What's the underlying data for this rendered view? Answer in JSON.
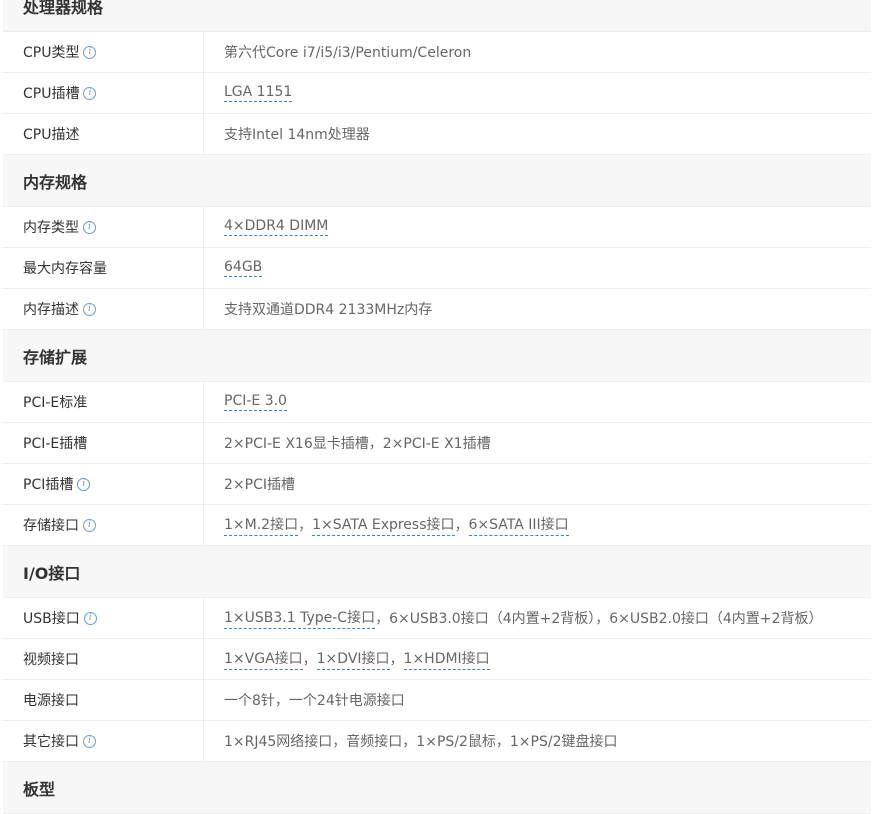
{
  "sections": [
    {
      "title": "处理器规格",
      "rows": [
        {
          "label": "CPU类型",
          "info": true,
          "parts": [
            {
              "text": "第六代Core i7/i5/i3/Pentium/Celeron",
              "link": false
            }
          ]
        },
        {
          "label": "CPU插槽",
          "info": true,
          "parts": [
            {
              "text": "LGA 1151",
              "link": true
            }
          ]
        },
        {
          "label": "CPU描述",
          "info": false,
          "parts": [
            {
              "text": "支持Intel 14nm处理器",
              "link": false
            }
          ]
        }
      ]
    },
    {
      "title": "内存规格",
      "rows": [
        {
          "label": "内存类型",
          "info": true,
          "parts": [
            {
              "text": "4×DDR4 DIMM",
              "link": true
            }
          ]
        },
        {
          "label": "最大内存容量",
          "info": false,
          "parts": [
            {
              "text": "64GB",
              "link": true
            }
          ]
        },
        {
          "label": "内存描述",
          "info": true,
          "parts": [
            {
              "text": "支持双通道DDR4 2133MHz内存",
              "link": false
            }
          ]
        }
      ]
    },
    {
      "title": "存储扩展",
      "rows": [
        {
          "label": "PCI-E标准",
          "info": false,
          "parts": [
            {
              "text": "PCI-E 3.0",
              "link": true
            }
          ]
        },
        {
          "label": "PCI-E插槽",
          "info": false,
          "parts": [
            {
              "text": "2×PCI-E X16显卡插槽，2×PCI-E X1插槽",
              "link": false
            }
          ]
        },
        {
          "label": "PCI插槽",
          "info": true,
          "parts": [
            {
              "text": "2×PCI插槽",
              "link": false
            }
          ]
        },
        {
          "label": "存储接口",
          "info": true,
          "parts": [
            {
              "text": "1×M.2接口",
              "link": true
            },
            {
              "text": "，",
              "link": false
            },
            {
              "text": "1×SATA Express接口",
              "link": true
            },
            {
              "text": "，",
              "link": false
            },
            {
              "text": "6×SATA III接口",
              "link": true
            }
          ]
        }
      ]
    },
    {
      "title": "I/O接口",
      "rows": [
        {
          "label": "USB接口",
          "info": true,
          "parts": [
            {
              "text": "1×USB3.1 Type-C接口",
              "link": true
            },
            {
              "text": "，6×USB3.0接口（4内置+2背板），6×USB2.0接口（4内置+2背板）",
              "link": false
            }
          ]
        },
        {
          "label": "视频接口",
          "info": false,
          "parts": [
            {
              "text": "1×VGA接口",
              "link": true
            },
            {
              "text": "，",
              "link": false
            },
            {
              "text": "1×DVI接口",
              "link": true
            },
            {
              "text": "，",
              "link": false
            },
            {
              "text": "1×HDMI接口",
              "link": true
            }
          ]
        },
        {
          "label": "电源接口",
          "info": false,
          "parts": [
            {
              "text": "一个8针，一个24针电源接口",
              "link": false
            }
          ]
        },
        {
          "label": "其它接口",
          "info": true,
          "parts": [
            {
              "text": "1×RJ45网络接口，音频接口，1×PS/2鼠标，1×PS/2键盘接口",
              "link": false
            }
          ]
        }
      ]
    },
    {
      "title": "板型",
      "rows": []
    }
  ],
  "icons": {
    "info": "info-circle-icon",
    "info_color": "#6a9bd6",
    "link_color": "#3f7fd0"
  }
}
